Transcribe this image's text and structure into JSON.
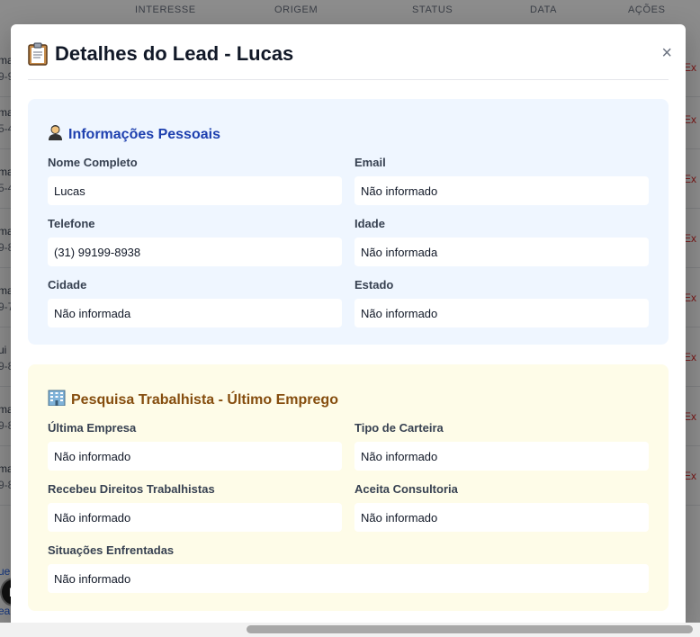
{
  "background": {
    "table_headers": [
      "INTERESSE",
      "ORIGEM",
      "STATUS",
      "DATA",
      "AÇÕES"
    ],
    "rows": [
      {
        "l1": "ma",
        "l2": "9-9",
        "action": "Ex"
      },
      {
        "l1": "ma",
        "l2": "5-4",
        "action": "Ex"
      },
      {
        "l1": "ma",
        "l2": "5-4",
        "action": "Ex"
      },
      {
        "l1": "ma",
        "l2": "9-8",
        "action": "Ex"
      },
      {
        "l1": "ma",
        "l2": "9-7",
        "action": "Ex"
      },
      {
        "l1": "ui",
        "l2": "9-8",
        "action": "Ex"
      },
      {
        "l1": "ma",
        "l2": "9-8",
        "action": "Ex"
      },
      {
        "l1": "ma",
        "l2": "9-8",
        "action": "Ex"
      }
    ],
    "link1": "ue",
    "link2": "ea",
    "badge": "N"
  },
  "modal": {
    "title": "Detalhes do Lead - Lucas",
    "close_label": "×",
    "personal": {
      "title": "Informações Pessoais",
      "fields": [
        {
          "label": "Nome Completo",
          "value": "Lucas"
        },
        {
          "label": "Email",
          "value": "Não informado"
        },
        {
          "label": "Telefone",
          "value": "(31) 99199-8938"
        },
        {
          "label": "Idade",
          "value": "Não informada"
        },
        {
          "label": "Cidade",
          "value": "Não informada"
        },
        {
          "label": "Estado",
          "value": "Não informado"
        }
      ]
    },
    "work": {
      "title": "Pesquisa Trabalhista - Último Emprego",
      "fields": [
        {
          "label": "Última Empresa",
          "value": "Não informado"
        },
        {
          "label": "Tipo de Carteira",
          "value": "Não informado"
        },
        {
          "label": "Recebeu Direitos Trabalhistas",
          "value": "Não informado"
        },
        {
          "label": "Aceita Consultoria",
          "value": "Não informado"
        },
        {
          "label": "Situações Enfrentadas",
          "value": "Não informado"
        }
      ]
    }
  },
  "colors": {
    "personal_bg": "#eff6ff",
    "personal_title": "#1e40af",
    "work_bg": "#fefce8",
    "work_title": "#854d0e",
    "action_red": "#dc2626"
  },
  "icons": {
    "title": "clipboard-icon",
    "personal": "person-icon",
    "work": "office-building-icon"
  }
}
